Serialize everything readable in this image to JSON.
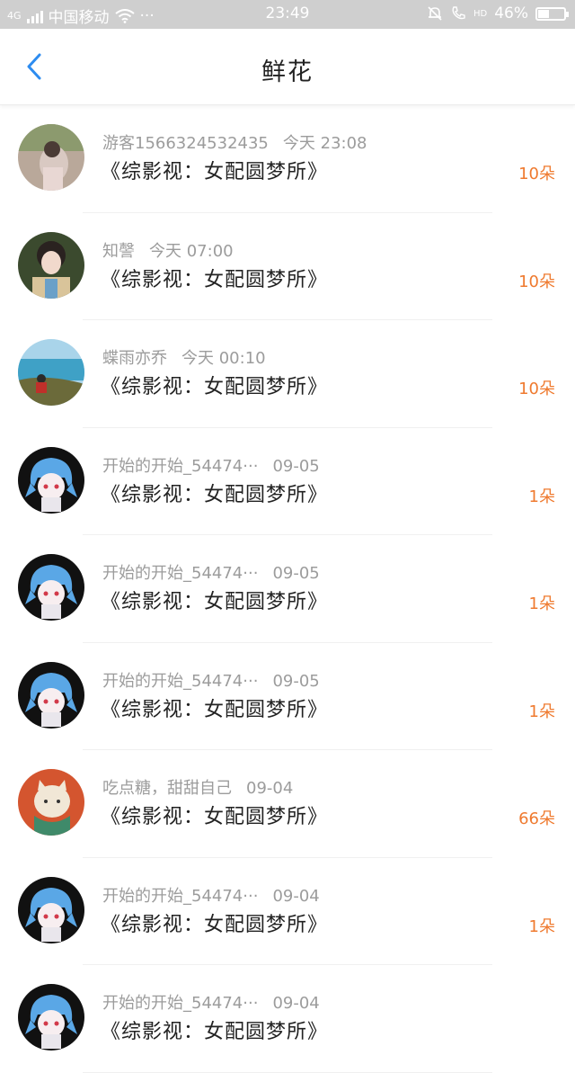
{
  "status_bar": {
    "network": "4G",
    "carrier": "中国移动",
    "dots": "···",
    "time": "23:49",
    "network_right": "HD",
    "battery": "46%",
    "battery_level": 0.46
  },
  "nav": {
    "title": "鲜花"
  },
  "colors": {
    "accent": "#2d8cf0",
    "count": "#ef7a2f",
    "meta": "#9c9c9c"
  },
  "items": [
    {
      "user": "游客1566324532435",
      "time": "今天 23:08",
      "book": "《综影视：女配圆梦所》",
      "count": "10朵",
      "avatar": "avatar-photo-girl-field"
    },
    {
      "user": "知謦",
      "time": "今天 07:00",
      "book": "《综影视：女配圆梦所》",
      "count": "10朵",
      "avatar": "avatar-photo-costume-girl"
    },
    {
      "user": "蝶雨亦乔",
      "time": "今天 00:10",
      "book": "《综影视：女配圆梦所》",
      "count": "10朵",
      "avatar": "avatar-photo-seaside"
    },
    {
      "user": "开始的开始_54474···",
      "time": "09-05",
      "book": "《综影视：女配圆梦所》",
      "count": "1朵",
      "avatar": "avatar-anime-blue-hair"
    },
    {
      "user": "开始的开始_54474···",
      "time": "09-05",
      "book": "《综影视：女配圆梦所》",
      "count": "1朵",
      "avatar": "avatar-anime-blue-hair"
    },
    {
      "user": "开始的开始_54474···",
      "time": "09-05",
      "book": "《综影视：女配圆梦所》",
      "count": "1朵",
      "avatar": "avatar-anime-blue-hair"
    },
    {
      "user": "吃点糖，甜甜自己",
      "time": "09-04",
      "book": "《综影视：女配圆梦所》",
      "count": "66朵",
      "avatar": "avatar-cat-illustration"
    },
    {
      "user": "开始的开始_54474···",
      "time": "09-04",
      "book": "《综影视：女配圆梦所》",
      "count": "1朵",
      "avatar": "avatar-anime-blue-hair"
    },
    {
      "user": "开始的开始_54474···",
      "time": "09-04",
      "book": "《综影视：女配圆梦所》",
      "count": "",
      "avatar": "avatar-anime-blue-hair"
    }
  ]
}
